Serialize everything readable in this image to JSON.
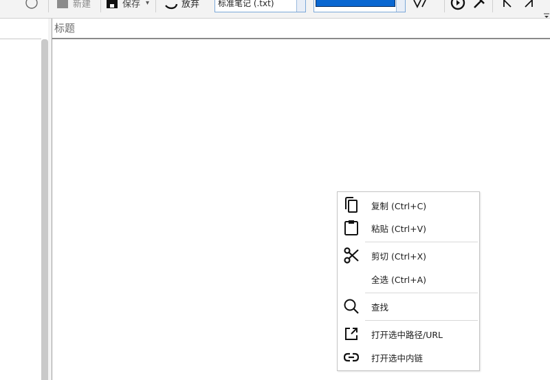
{
  "toolbar": {
    "new_label": "新建",
    "save_label": "保存",
    "discard_label": "放弃",
    "format_select_value": "标准笔记 (.txt)",
    "accent_color": "#0a67d1"
  },
  "editor": {
    "title_placeholder": "标题",
    "body_text": ""
  },
  "context_menu": {
    "items": [
      {
        "label": "复制 (Ctrl+C)",
        "icon": "copy-icon"
      },
      {
        "label": "粘贴 (Ctrl+V)",
        "icon": "paste-icon"
      },
      {
        "label": "剪切 (Ctrl+X)",
        "icon": "cut-icon"
      },
      {
        "label": "全选 (Ctrl+A)",
        "icon": ""
      },
      {
        "label": "查找",
        "icon": "search-icon"
      },
      {
        "label": "打开选中路径/URL",
        "icon": "open-external-icon"
      },
      {
        "label": "打开选中内链",
        "icon": "link-icon"
      }
    ]
  }
}
